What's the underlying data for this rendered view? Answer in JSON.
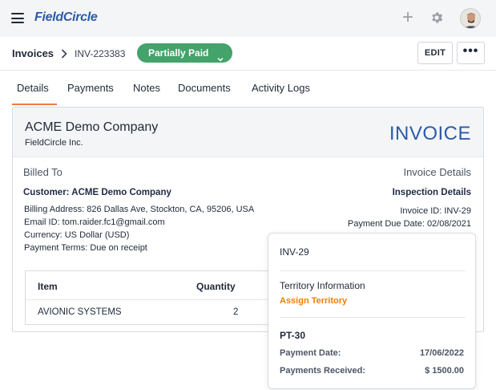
{
  "app": {
    "logo_part1": "Field",
    "logo_part2": "Circle",
    "menu_icon": "hamburger-icon",
    "add_icon": "plus-icon",
    "settings_icon": "gear-icon",
    "avatar_icon": "user-avatar"
  },
  "breadcrumb": {
    "section": "Invoices",
    "invoice_id": "INV-223383"
  },
  "status": {
    "label": "Partially Paid",
    "color": "#43a36a"
  },
  "actions": {
    "edit_label": "EDIT",
    "more_label": "•••"
  },
  "tabs": [
    {
      "label": "Details",
      "active": true
    },
    {
      "label": "Payments"
    },
    {
      "label": "Notes"
    },
    {
      "label": "Documents"
    },
    {
      "label": "Activity Logs"
    }
  ],
  "invoice": {
    "company": "ACME Demo Company",
    "company_sub": "FieldCircle Inc.",
    "title": "INVOICE",
    "billed_to_heading": "Billed To",
    "details_heading": "Invoice Details",
    "customer": "Customer: ACME Demo Company",
    "billing_address": "Billing Address: 826 Dallas Ave, Stockton, CA, 95206, USA",
    "email": "Email ID: tom.raider.fc1@gmail.com",
    "currency": "Currency: US Dollar (USD)",
    "payment_terms": "Payment Terms: Due on receipt",
    "inspection_heading": "Inspection Details",
    "invoice_id_line": "Invoice ID: INV-29",
    "due_date_line": "Payment Due Date: 02/08/2021",
    "table": {
      "headers": [
        "Item",
        "Quantity"
      ],
      "rows": [
        [
          "AVIONIC SYSTEMS",
          "2"
        ]
      ]
    }
  },
  "popover": {
    "id": "INV-29",
    "territory_heading": "Territory Information",
    "assign_label": "Assign Territory",
    "payment_ref": "PT-30",
    "payment_date_label": "Payment Date:",
    "payment_date_value": "17/06/2022",
    "received_label": "Payments Received:",
    "received_value": "$ 1500.00"
  },
  "colors": {
    "accent_blue": "#2d5aa8",
    "tab_active": "#f07d3a",
    "assign_orange": "#f07d00"
  }
}
